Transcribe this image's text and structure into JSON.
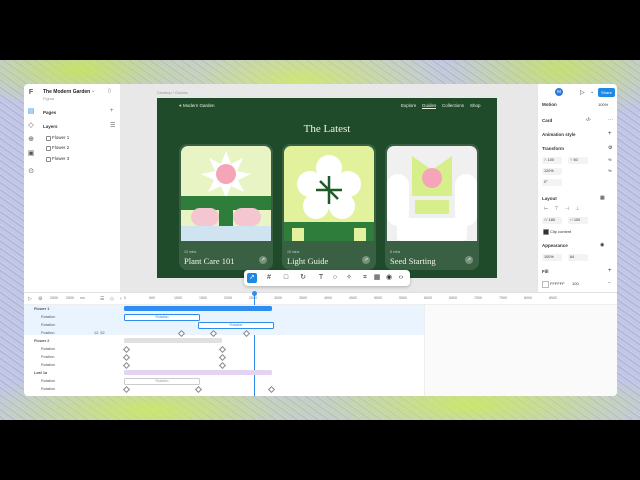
{
  "app": {
    "project_name": "The Modern Garden",
    "project_sub": "Figma",
    "pages_label": "Pages",
    "layers_label": "Layers",
    "layers": [
      "Flower 1",
      "Flower 2",
      "Flower 3"
    ]
  },
  "canvas": {
    "frame_label": "Desktop / Guides",
    "site": {
      "logo": "Modern Garden",
      "nav": [
        "Explore",
        "Guides",
        "Collections",
        "Shop"
      ],
      "active_nav": "Guides",
      "heading": "The Latest",
      "cards": [
        {
          "sub": "10 mins",
          "title": "Plant Care 101"
        },
        {
          "sub": "15 mins",
          "title": "Light Guide"
        },
        {
          "sub": "8 mins",
          "title": "Seed Starting"
        }
      ]
    },
    "toolbar_icons": [
      "cursor-icon",
      "frame-icon",
      "rectangle-icon",
      "rotate-icon",
      "text-icon",
      "comment-icon",
      "pen-icon",
      "component-icon",
      "grid-icon",
      "eye-icon",
      "code-icon"
    ]
  },
  "right_panel": {
    "avatar": "M",
    "share_label": "Share",
    "motion_label": "Motion",
    "zoom": "100%",
    "element_name": "Card",
    "animation_style_label": "Animation style",
    "transform_label": "Transform",
    "x_label": "X",
    "x_value": "100",
    "y_label": "Y",
    "y_value": "50",
    "scale_value": "120%",
    "rotation_value": "0°",
    "layout_label": "Layout",
    "w_label": "W",
    "w_value": "180",
    "h_label": "H",
    "h_value": "100",
    "clip_label": "Clip content",
    "appearance_label": "Appearance",
    "opacity_value": "100%",
    "radius_value": "64",
    "fill_label": "Fill",
    "fill_hex": "FFFFFF",
    "fill_opacity": "100"
  },
  "timeline": {
    "start": "2500",
    "end": "2500",
    "unit": "ms",
    "ticks": [
      "0",
      "500",
      "1000",
      "1500",
      "2000",
      "2500",
      "3000",
      "3500",
      "4000",
      "4500",
      "5000",
      "5500",
      "6000",
      "6500",
      "7000",
      "7500",
      "8000",
      "8500"
    ],
    "rows": [
      {
        "label": "Flower 1",
        "type": "group"
      },
      {
        "label": "Rotation",
        "type": "prop"
      },
      {
        "label": "Rotation",
        "type": "prop"
      },
      {
        "label": "Position",
        "type": "prop",
        "value": "12, 52"
      },
      {
        "label": "Flower 2",
        "type": "group"
      },
      {
        "label": "Rotation",
        "type": "prop"
      },
      {
        "label": "Position",
        "type": "prop"
      },
      {
        "label": "Rotation",
        "type": "prop"
      },
      {
        "label": "Leaf 1a",
        "type": "group"
      },
      {
        "label": "Rotation",
        "type": "prop"
      },
      {
        "label": "Rotation",
        "type": "prop"
      }
    ],
    "bar_labels": [
      "Rotation",
      "Rotation",
      "Rotation"
    ]
  },
  "colors": {
    "accent": "#1e88e5",
    "site_bg": "#1f4b2a",
    "flower_pink": "#f4a6b8",
    "leaf_green": "#2e7d3a",
    "lime": "#d6ef8a",
    "purple_bar": "#e3d3f5"
  }
}
